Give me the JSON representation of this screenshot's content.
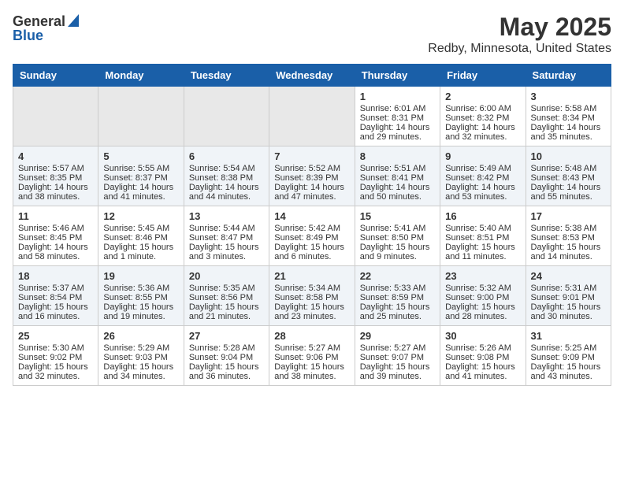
{
  "header": {
    "logo_general": "General",
    "logo_blue": "Blue",
    "title": "May 2025",
    "subtitle": "Redby, Minnesota, United States"
  },
  "weekdays": [
    "Sunday",
    "Monday",
    "Tuesday",
    "Wednesday",
    "Thursday",
    "Friday",
    "Saturday"
  ],
  "rows": [
    [
      {
        "day": "",
        "empty": true
      },
      {
        "day": "",
        "empty": true
      },
      {
        "day": "",
        "empty": true
      },
      {
        "day": "",
        "empty": true
      },
      {
        "day": "1",
        "sunrise": "Sunrise: 6:01 AM",
        "sunset": "Sunset: 8:31 PM",
        "daylight": "Daylight: 14 hours and 29 minutes."
      },
      {
        "day": "2",
        "sunrise": "Sunrise: 6:00 AM",
        "sunset": "Sunset: 8:32 PM",
        "daylight": "Daylight: 14 hours and 32 minutes."
      },
      {
        "day": "3",
        "sunrise": "Sunrise: 5:58 AM",
        "sunset": "Sunset: 8:34 PM",
        "daylight": "Daylight: 14 hours and 35 minutes."
      }
    ],
    [
      {
        "day": "4",
        "sunrise": "Sunrise: 5:57 AM",
        "sunset": "Sunset: 8:35 PM",
        "daylight": "Daylight: 14 hours and 38 minutes."
      },
      {
        "day": "5",
        "sunrise": "Sunrise: 5:55 AM",
        "sunset": "Sunset: 8:37 PM",
        "daylight": "Daylight: 14 hours and 41 minutes."
      },
      {
        "day": "6",
        "sunrise": "Sunrise: 5:54 AM",
        "sunset": "Sunset: 8:38 PM",
        "daylight": "Daylight: 14 hours and 44 minutes."
      },
      {
        "day": "7",
        "sunrise": "Sunrise: 5:52 AM",
        "sunset": "Sunset: 8:39 PM",
        "daylight": "Daylight: 14 hours and 47 minutes."
      },
      {
        "day": "8",
        "sunrise": "Sunrise: 5:51 AM",
        "sunset": "Sunset: 8:41 PM",
        "daylight": "Daylight: 14 hours and 50 minutes."
      },
      {
        "day": "9",
        "sunrise": "Sunrise: 5:49 AM",
        "sunset": "Sunset: 8:42 PM",
        "daylight": "Daylight: 14 hours and 53 minutes."
      },
      {
        "day": "10",
        "sunrise": "Sunrise: 5:48 AM",
        "sunset": "Sunset: 8:43 PM",
        "daylight": "Daylight: 14 hours and 55 minutes."
      }
    ],
    [
      {
        "day": "11",
        "sunrise": "Sunrise: 5:46 AM",
        "sunset": "Sunset: 8:45 PM",
        "daylight": "Daylight: 14 hours and 58 minutes."
      },
      {
        "day": "12",
        "sunrise": "Sunrise: 5:45 AM",
        "sunset": "Sunset: 8:46 PM",
        "daylight": "Daylight: 15 hours and 1 minute."
      },
      {
        "day": "13",
        "sunrise": "Sunrise: 5:44 AM",
        "sunset": "Sunset: 8:47 PM",
        "daylight": "Daylight: 15 hours and 3 minutes."
      },
      {
        "day": "14",
        "sunrise": "Sunrise: 5:42 AM",
        "sunset": "Sunset: 8:49 PM",
        "daylight": "Daylight: 15 hours and 6 minutes."
      },
      {
        "day": "15",
        "sunrise": "Sunrise: 5:41 AM",
        "sunset": "Sunset: 8:50 PM",
        "daylight": "Daylight: 15 hours and 9 minutes."
      },
      {
        "day": "16",
        "sunrise": "Sunrise: 5:40 AM",
        "sunset": "Sunset: 8:51 PM",
        "daylight": "Daylight: 15 hours and 11 minutes."
      },
      {
        "day": "17",
        "sunrise": "Sunrise: 5:38 AM",
        "sunset": "Sunset: 8:53 PM",
        "daylight": "Daylight: 15 hours and 14 minutes."
      }
    ],
    [
      {
        "day": "18",
        "sunrise": "Sunrise: 5:37 AM",
        "sunset": "Sunset: 8:54 PM",
        "daylight": "Daylight: 15 hours and 16 minutes."
      },
      {
        "day": "19",
        "sunrise": "Sunrise: 5:36 AM",
        "sunset": "Sunset: 8:55 PM",
        "daylight": "Daylight: 15 hours and 19 minutes."
      },
      {
        "day": "20",
        "sunrise": "Sunrise: 5:35 AM",
        "sunset": "Sunset: 8:56 PM",
        "daylight": "Daylight: 15 hours and 21 minutes."
      },
      {
        "day": "21",
        "sunrise": "Sunrise: 5:34 AM",
        "sunset": "Sunset: 8:58 PM",
        "daylight": "Daylight: 15 hours and 23 minutes."
      },
      {
        "day": "22",
        "sunrise": "Sunrise: 5:33 AM",
        "sunset": "Sunset: 8:59 PM",
        "daylight": "Daylight: 15 hours and 25 minutes."
      },
      {
        "day": "23",
        "sunrise": "Sunrise: 5:32 AM",
        "sunset": "Sunset: 9:00 PM",
        "daylight": "Daylight: 15 hours and 28 minutes."
      },
      {
        "day": "24",
        "sunrise": "Sunrise: 5:31 AM",
        "sunset": "Sunset: 9:01 PM",
        "daylight": "Daylight: 15 hours and 30 minutes."
      }
    ],
    [
      {
        "day": "25",
        "sunrise": "Sunrise: 5:30 AM",
        "sunset": "Sunset: 9:02 PM",
        "daylight": "Daylight: 15 hours and 32 minutes."
      },
      {
        "day": "26",
        "sunrise": "Sunrise: 5:29 AM",
        "sunset": "Sunset: 9:03 PM",
        "daylight": "Daylight: 15 hours and 34 minutes."
      },
      {
        "day": "27",
        "sunrise": "Sunrise: 5:28 AM",
        "sunset": "Sunset: 9:04 PM",
        "daylight": "Daylight: 15 hours and 36 minutes."
      },
      {
        "day": "28",
        "sunrise": "Sunrise: 5:27 AM",
        "sunset": "Sunset: 9:06 PM",
        "daylight": "Daylight: 15 hours and 38 minutes."
      },
      {
        "day": "29",
        "sunrise": "Sunrise: 5:27 AM",
        "sunset": "Sunset: 9:07 PM",
        "daylight": "Daylight: 15 hours and 39 minutes."
      },
      {
        "day": "30",
        "sunrise": "Sunrise: 5:26 AM",
        "sunset": "Sunset: 9:08 PM",
        "daylight": "Daylight: 15 hours and 41 minutes."
      },
      {
        "day": "31",
        "sunrise": "Sunrise: 5:25 AM",
        "sunset": "Sunset: 9:09 PM",
        "daylight": "Daylight: 15 hours and 43 minutes."
      }
    ]
  ]
}
